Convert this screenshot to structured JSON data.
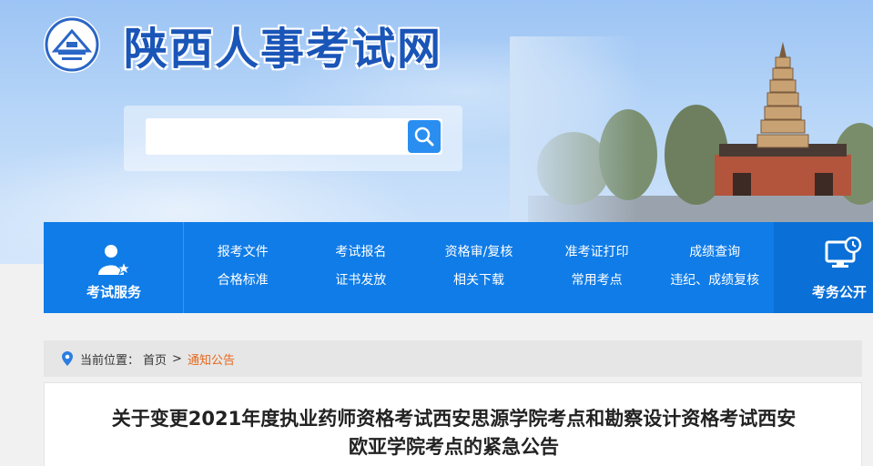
{
  "header": {
    "site_title": "陕西人事考试网",
    "search_placeholder": ""
  },
  "nav": {
    "left_label": "考试服务",
    "right_label": "考务公开",
    "links": [
      "报考文件",
      "考试报名",
      "资格审/复核",
      "准考证打印",
      "成绩查询",
      "合格标准",
      "证书发放",
      "相关下载",
      "常用考点",
      "违纪、成绩复核"
    ]
  },
  "breadcrumb": {
    "prefix": "当前位置：",
    "home": "首页",
    "separator": ">",
    "current": "通知公告"
  },
  "article": {
    "title_line1": "关于变更2021年度执业药师资格考试西安思源学院考点和勘察设计资格考试西安",
    "title_line2": "欧亚学院考点的紧急公告"
  },
  "colors": {
    "nav_blue": "#0f7ce8",
    "title_blue": "#1a55b8",
    "current_orange": "#e6671a"
  }
}
